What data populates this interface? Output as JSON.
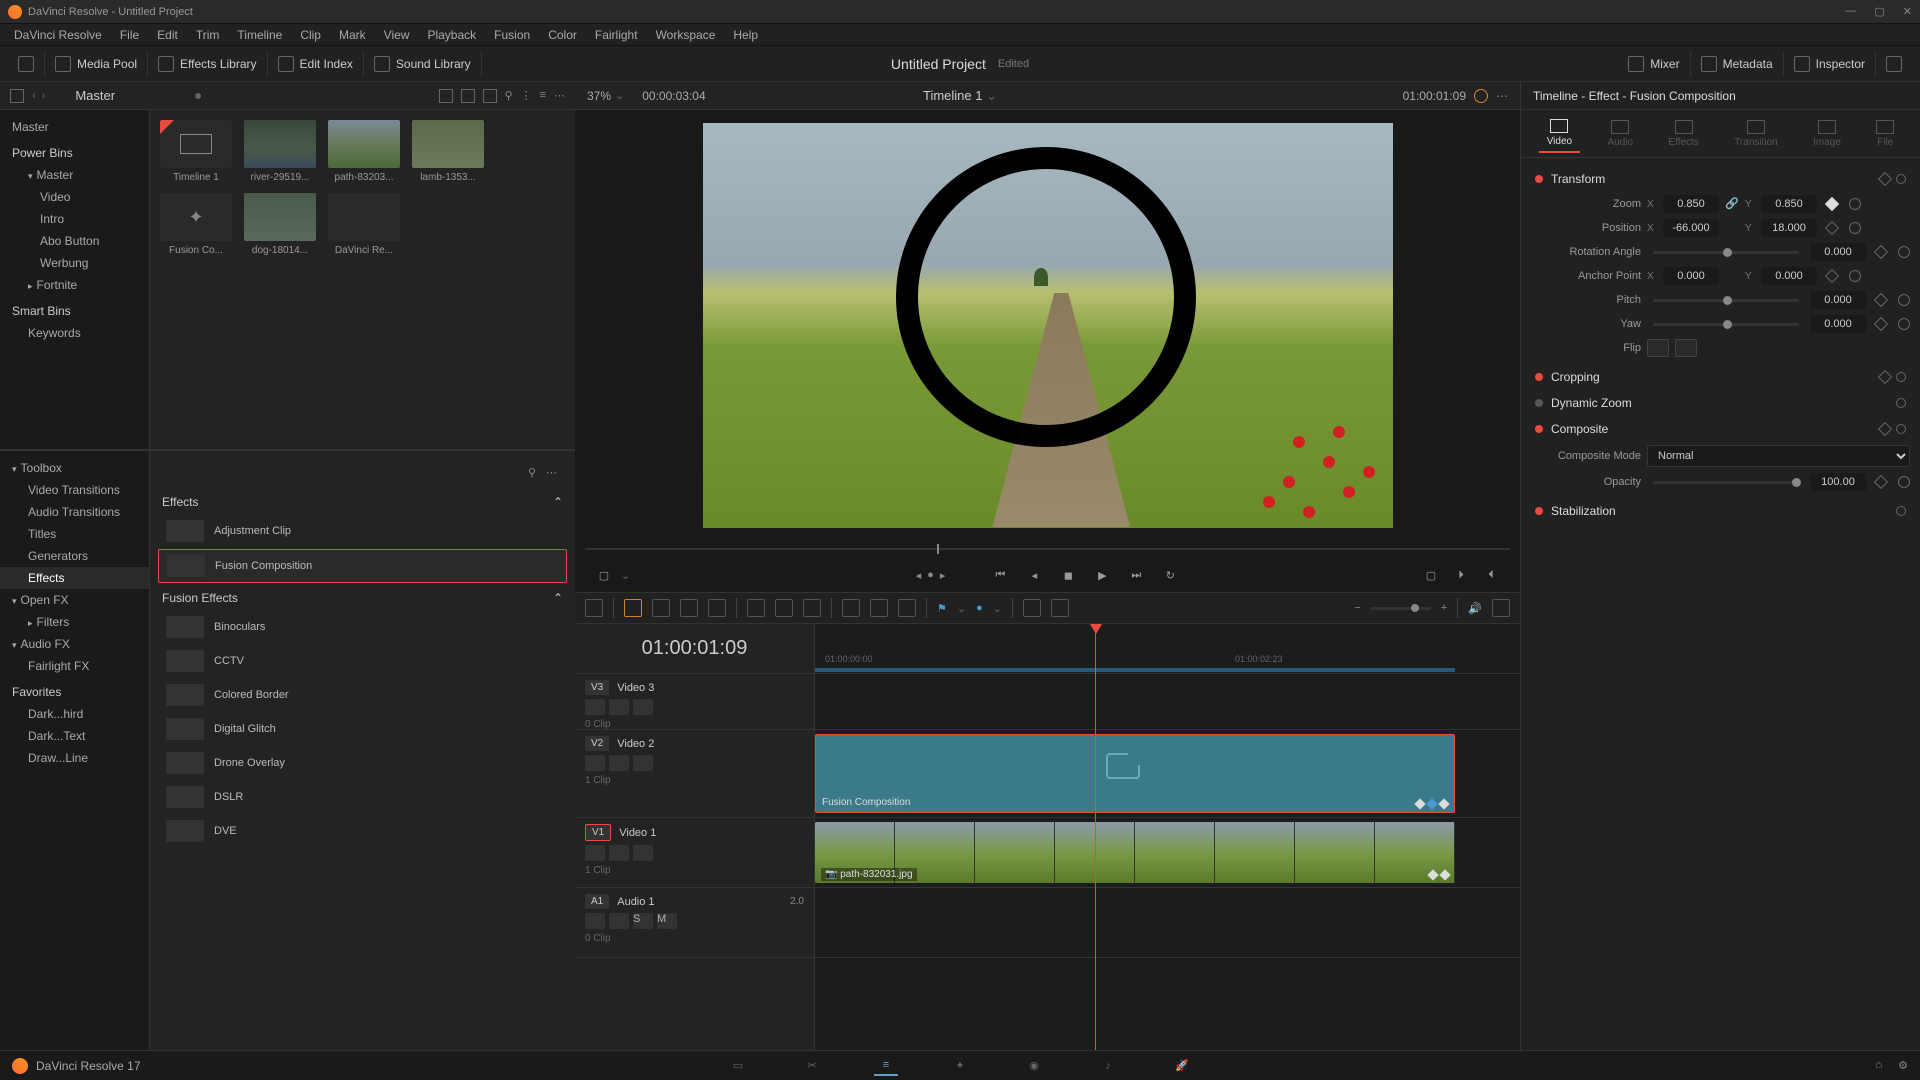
{
  "window": {
    "title": "DaVinci Resolve - Untitled Project"
  },
  "menu": [
    "DaVinci Resolve",
    "File",
    "Edit",
    "Trim",
    "Timeline",
    "Clip",
    "Mark",
    "View",
    "Playback",
    "Fusion",
    "Color",
    "Fairlight",
    "Workspace",
    "Help"
  ],
  "toolbar": {
    "media_pool": "Media Pool",
    "effects_library": "Effects Library",
    "edit_index": "Edit Index",
    "sound_library": "Sound Library",
    "mixer": "Mixer",
    "metadata": "Metadata",
    "inspector": "Inspector",
    "project_title": "Untitled Project",
    "project_status": "Edited"
  },
  "pool": {
    "breadcrumb": "Master",
    "tree": {
      "master": "Master",
      "power_bins": "Power Bins",
      "pb_master": "Master",
      "video": "Video",
      "intro": "Intro",
      "abo_button": "Abo Button",
      "werbung": "Werbung",
      "fortnite": "Fortnite",
      "smart_bins": "Smart Bins",
      "keywords": "Keywords"
    },
    "clips": {
      "timeline1": "Timeline 1",
      "river": "river-29519...",
      "path": "path-83203...",
      "lamb": "lamb-1353...",
      "fusion_comp": "Fusion Co...",
      "dog": "dog-18014...",
      "dvr": "DaVinci Re..."
    }
  },
  "effects": {
    "tree": {
      "toolbox": "Toolbox",
      "video_transitions": "Video Transitions",
      "audio_transitions": "Audio Transitions",
      "titles": "Titles",
      "generators": "Generators",
      "effects": "Effects",
      "open_fx": "Open FX",
      "filters": "Filters",
      "audio_fx": "Audio FX",
      "fairlight_fx": "Fairlight FX",
      "favorites": "Favorites",
      "fav1": "Dark...hird",
      "fav2": "Dark...Text",
      "fav3": "Draw...Line"
    },
    "cat_effects": "Effects",
    "cat_fusion": "Fusion Effects",
    "items": {
      "adjustment": "Adjustment Clip",
      "fusion_comp": "Fusion Composition",
      "binoculars": "Binoculars",
      "cctv": "CCTV",
      "colored_border": "Colored Border",
      "digital_glitch": "Digital Glitch",
      "drone_overlay": "Drone Overlay",
      "dslr": "DSLR",
      "dve": "DVE"
    }
  },
  "viewer": {
    "zoom": "37%",
    "tc_left": "00:00:03:04",
    "timeline_name": "Timeline 1",
    "tc_right": "01:00:01:09"
  },
  "timeline": {
    "tc": "01:00:01:09",
    "ruler": {
      "t1": "01:00:00:00",
      "t2": "01:00:02:23"
    },
    "tracks": {
      "v3_name": "Video 3",
      "v2": "V2",
      "v2_name": "Video 2",
      "v1": "V1",
      "v1_name": "Video 1",
      "a1": "A1",
      "a1_name": "Audio 1",
      "a1_ch": "2.0",
      "clips0": "0 Clip",
      "clips1": "1 Clip"
    },
    "fusion_clip_label": "Fusion Composition",
    "video_clip_label": "path-832031.jpg"
  },
  "inspector": {
    "header": "Timeline - Effect - Fusion Composition",
    "tabs": {
      "video": "Video",
      "audio": "Audio",
      "effects": "Effects",
      "transition": "Transition",
      "image": "Image",
      "file": "File"
    },
    "transform": {
      "title": "Transform",
      "zoom": "Zoom",
      "zoom_x": "0.850",
      "zoom_y": "0.850",
      "position": "Position",
      "pos_x": "-66.000",
      "pos_y": "18.000",
      "rotation": "Rotation Angle",
      "rotation_val": "0.000",
      "anchor": "Anchor Point",
      "anchor_x": "0.000",
      "anchor_y": "0.000",
      "pitch": "Pitch",
      "pitch_val": "0.000",
      "yaw": "Yaw",
      "yaw_val": "0.000",
      "flip": "Flip"
    },
    "cropping": "Cropping",
    "dynamic_zoom": "Dynamic Zoom",
    "composite": {
      "title": "Composite",
      "mode_label": "Composite Mode",
      "mode_value": "Normal",
      "opacity_label": "Opacity",
      "opacity_value": "100.00"
    },
    "stabilization": "Stabilization"
  },
  "footer": {
    "app": "DaVinci Resolve 17"
  },
  "axis": {
    "x": "X",
    "y": "Y"
  }
}
